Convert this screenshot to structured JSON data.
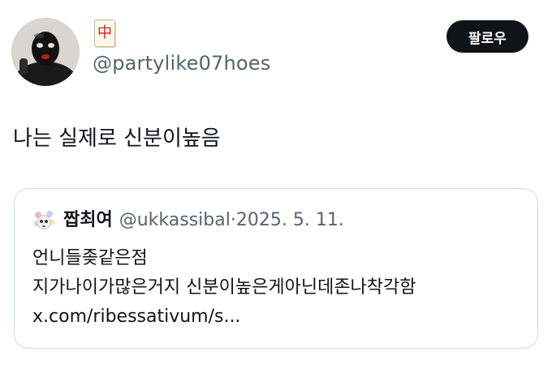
{
  "author": {
    "name_badge": "中",
    "handle": "@partylike07hoes"
  },
  "follow_button": {
    "label": "팔로우"
  },
  "post": {
    "text": "나는 실제로 신분이높음"
  },
  "quote": {
    "name": "짭최여",
    "handle": "@ukkassibal",
    "separator": "·",
    "date": "2025. 5. 11.",
    "lines": [
      "언니들좆같은점",
      "지가나이가많은거지 신분이높은게아닌데존나착각함",
      "x.com/ribessativum/s..."
    ]
  },
  "colors": {
    "text_primary": "#0f1419",
    "text_secondary": "#536471",
    "border": "#cfd9de",
    "follow_bg": "#0f1419",
    "badge_red": "#c62828"
  },
  "icons": {
    "avatar": "profile-avatar-image",
    "badge": "mahjong-red-dragon-tile",
    "quote_avatar": "flower-skull-avatar-image"
  }
}
